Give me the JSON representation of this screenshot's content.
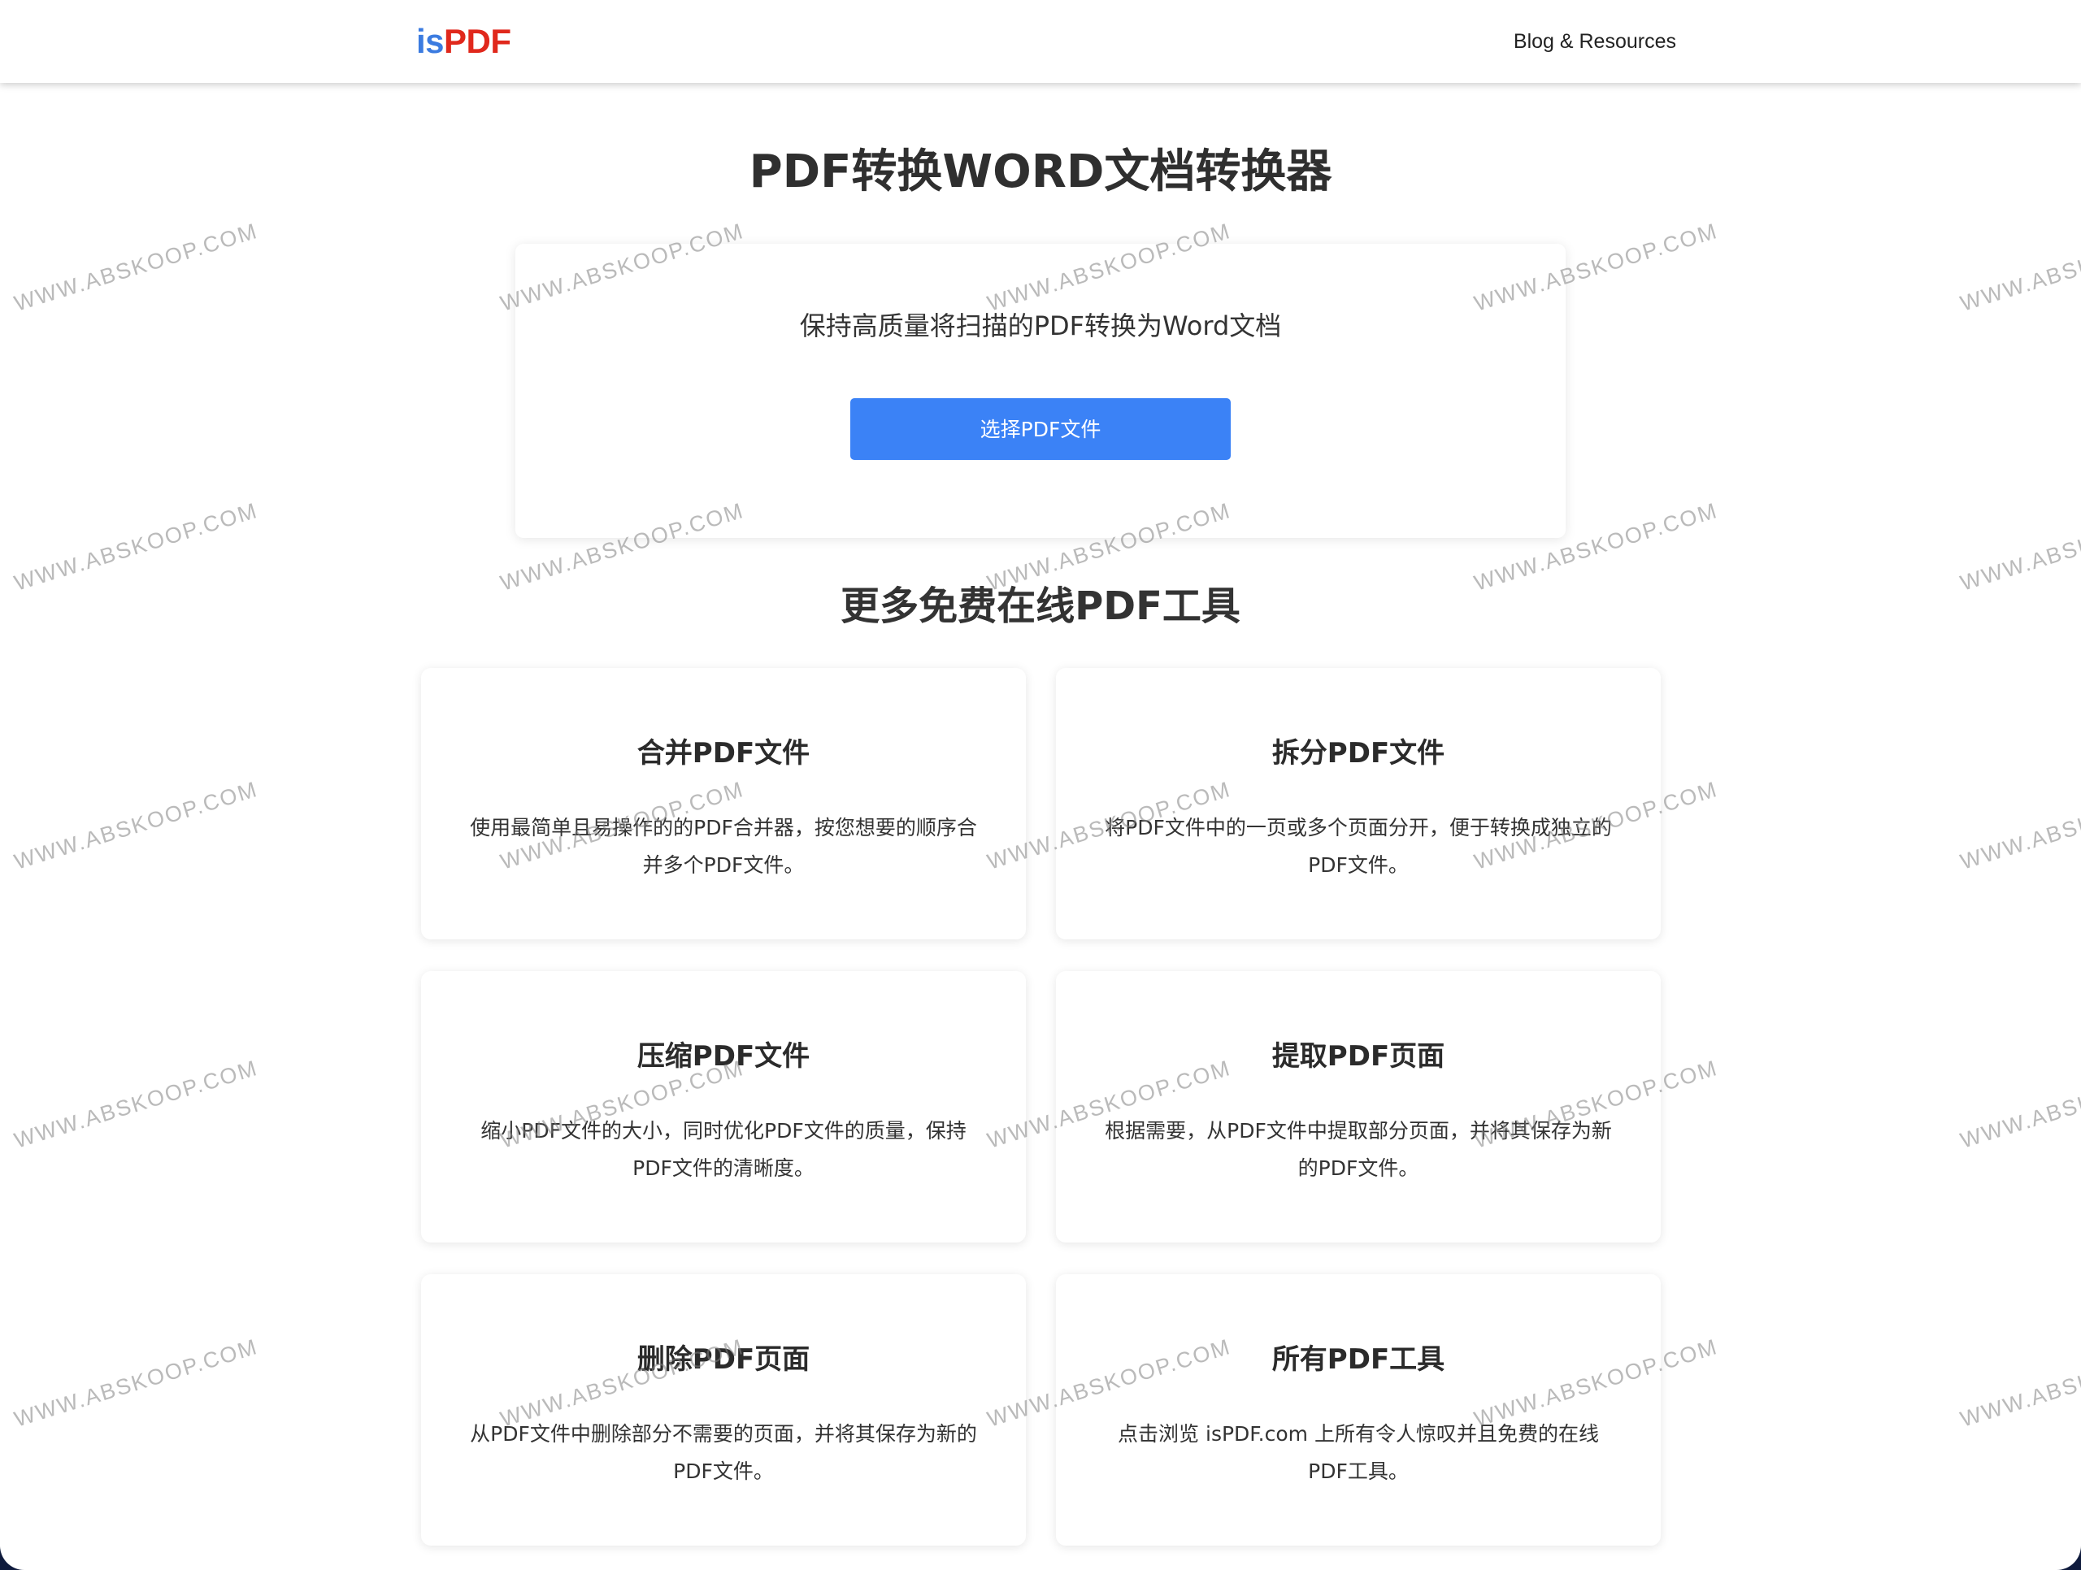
{
  "header": {
    "logo_part1": "is",
    "logo_part2": "PDF",
    "nav_link": "Blog & Resources"
  },
  "hero": {
    "title": "PDF转换WORD文档转换器",
    "description": "保持高质量将扫描的PDF转换为Word文档",
    "button_label": "选择PDF文件"
  },
  "tools_section": {
    "title": "更多免费在线PDF工具",
    "tools": [
      {
        "title": "合并PDF文件",
        "description": "使用最简单且易操作的的PDF合并器，按您想要的顺序合并多个PDF文件。"
      },
      {
        "title": "拆分PDF文件",
        "description": "将PDF文件中的一页或多个页面分开，便于转换成独立的PDF文件。"
      },
      {
        "title": "压缩PDF文件",
        "description": "缩小PDF文件的大小，同时优化PDF文件的质量，保持PDF文件的清晰度。"
      },
      {
        "title": "提取PDF页面",
        "description": "根据需要，从PDF文件中提取部分页面，并将其保存为新的PDF文件。"
      },
      {
        "title": "删除PDF页面",
        "description": "从PDF文件中删除部分不需要的页面，并将其保存为新的PDF文件。"
      },
      {
        "title": "所有PDF工具",
        "description": "点击浏览 isPDF.com 上所有令人惊叹并且免费的在线PDF工具。"
      }
    ]
  },
  "watermark_text": "WWW.ABSKOOP.COM",
  "colors": {
    "logo_is": "#3b7be0",
    "logo_pdf": "#e0281c",
    "button_bg": "#3b82f6",
    "outer_bg": "#0f1b3d"
  }
}
